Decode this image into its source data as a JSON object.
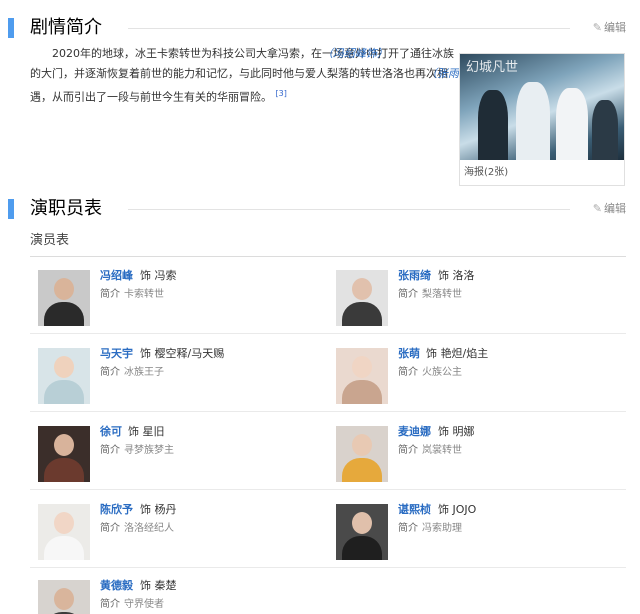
{
  "synopsis_section": {
    "title": "剧情简介",
    "edit_label": "编辑",
    "text_a": "2020年的地球，冰王卡索转世为科技公司大拿冯索",
    "actor_1": "（冯绍峰饰）",
    "text_b": "，在一场意外中打开了通往冰族的大门，并逐渐恢复着前世的能力和记忆，与此同时他与爱人梨落的转世洛洛",
    "actor_2": "（张雨绮饰）",
    "text_c": "也再次相遇，从而引出了一段与前世今生有关的华丽冒险。",
    "ref": "[3]",
    "poster_logo": "幻城凡世",
    "poster_caption": "海报(2张)"
  },
  "cast_section": {
    "title": "演职员表",
    "edit_label": "编辑",
    "subtitle": "演员表",
    "intro_label": "简介",
    "role_prefix": "饰",
    "actors": [
      {
        "name": "冯绍峰",
        "role": "冯索",
        "intro": "卡索转世"
      },
      {
        "name": "张雨绮",
        "role": "洛洛",
        "intro": "梨落转世"
      },
      {
        "name": "马天宇",
        "role": "樱空释/马天赐",
        "intro": "冰族王子"
      },
      {
        "name": "张萌",
        "role": "艳炟/焰主",
        "intro": "火族公主"
      },
      {
        "name": "徐可",
        "role": "星旧",
        "intro": "寻梦族梦主"
      },
      {
        "name": "麦迪娜",
        "role": "明娜",
        "intro": "岚裳转世"
      },
      {
        "name": "陈欣予",
        "role": "杨丹",
        "intro": "洛洛经纪人"
      },
      {
        "name": "谌熙桢",
        "role": "JOJO",
        "intro": "冯索助理"
      },
      {
        "name": "黄德毅",
        "role": "秦楚",
        "intro": "守界使者"
      }
    ]
  },
  "colors": {
    "accent_bar": "#4f9cee",
    "link_blue": "#2a6cc2"
  }
}
